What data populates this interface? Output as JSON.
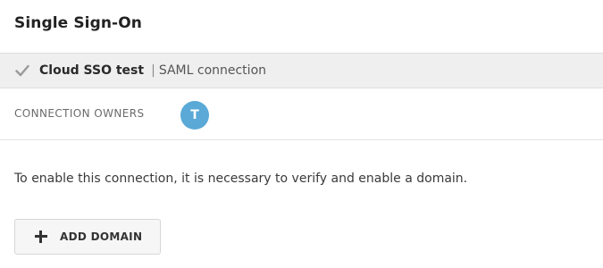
{
  "page": {
    "title": "Single Sign-On"
  },
  "connection": {
    "name": "Cloud SSO test",
    "separator": "|",
    "type": "SAML connection",
    "status_icon": "check-icon"
  },
  "owners": {
    "label": "CONNECTION OWNERS",
    "avatars": [
      {
        "initial": "T",
        "color": "#5aa9d6"
      }
    ]
  },
  "message": "To enable this connection, it is necessary to verify and enable a domain.",
  "actions": {
    "add_domain_label": "ADD DOMAIN",
    "add_domain_icon": "plus-icon"
  }
}
